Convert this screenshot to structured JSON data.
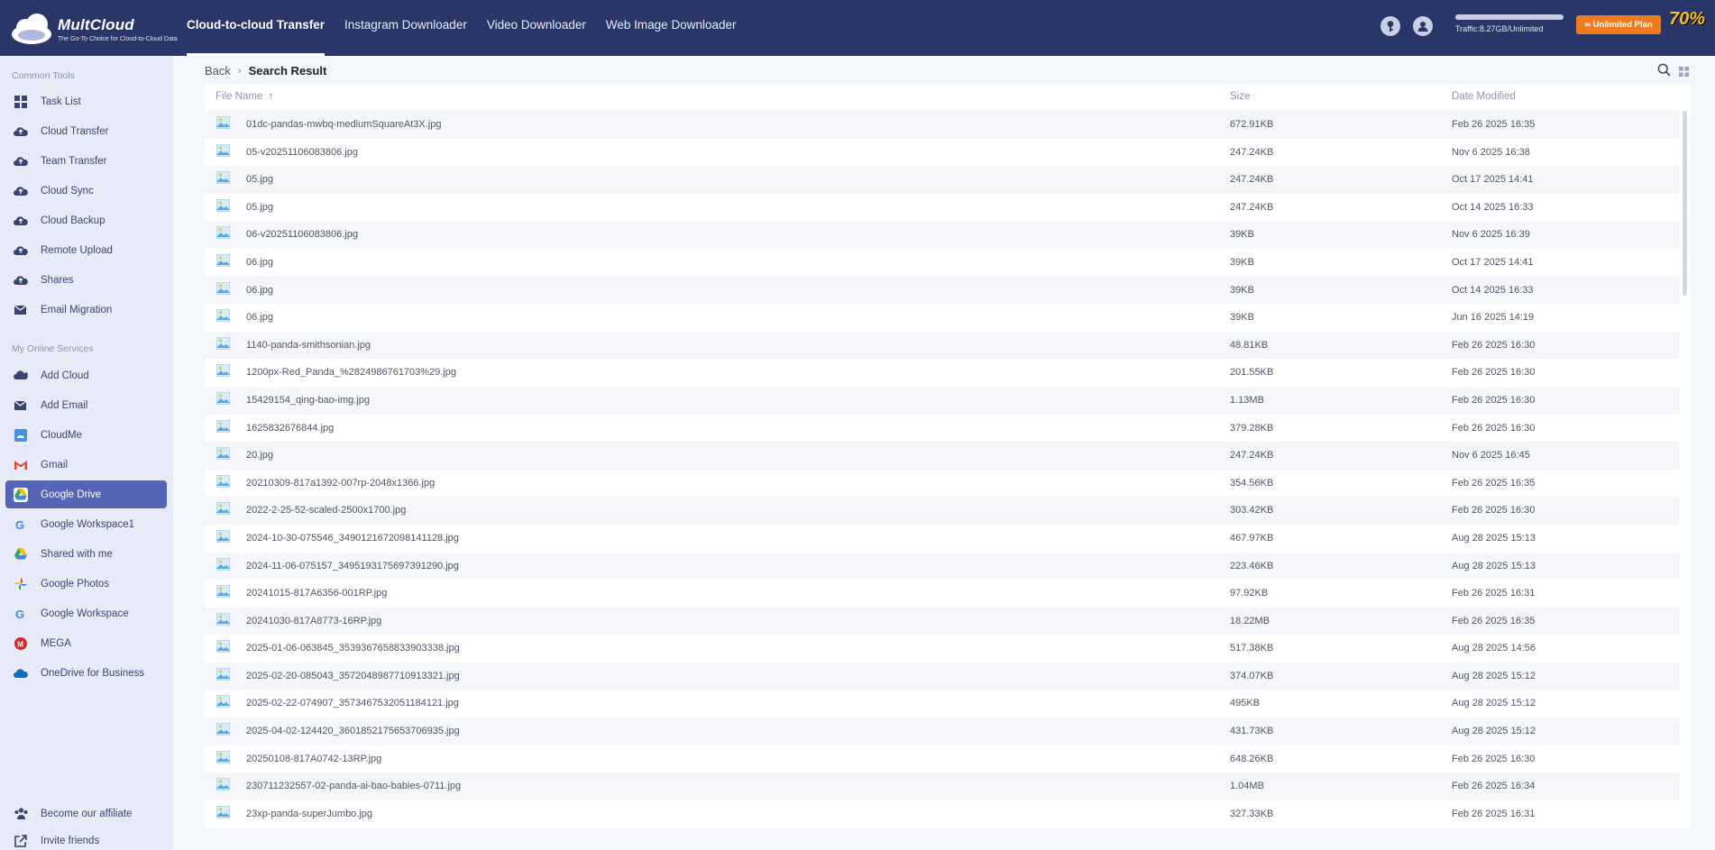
{
  "app": {
    "name": "MultCloud",
    "tagline": "The Go-To Choice for Cloud-to-Cloud Data"
  },
  "topnav": {
    "items": [
      {
        "label": "Cloud-to-cloud Transfer",
        "active": true
      },
      {
        "label": "Instagram Downloader",
        "active": false
      },
      {
        "label": "Video Downloader",
        "active": false
      },
      {
        "label": "Web Image Downloader",
        "active": false
      }
    ]
  },
  "header": {
    "traffic_text": "Traffic:8.27GB/Unlimited",
    "plan_label": "∞ Unlimited Plan",
    "promo_text": "70%"
  },
  "sidebar": {
    "common_title": "Common Tools",
    "common": [
      {
        "label": "Task List",
        "icon": "grid-icon"
      },
      {
        "label": "Cloud Transfer",
        "icon": "cloud-transfer-icon"
      },
      {
        "label": "Team Transfer",
        "icon": "team-transfer-icon"
      },
      {
        "label": "Cloud Sync",
        "icon": "cloud-sync-icon"
      },
      {
        "label": "Cloud Backup",
        "icon": "cloud-backup-icon"
      },
      {
        "label": "Remote Upload",
        "icon": "remote-upload-icon"
      },
      {
        "label": "Shares",
        "icon": "shares-icon"
      },
      {
        "label": "Email Migration",
        "icon": "email-migration-icon"
      }
    ],
    "services_title": "My Online Services",
    "services": [
      {
        "label": "Add Cloud",
        "icon": "add-cloud-icon"
      },
      {
        "label": "Add Email",
        "icon": "add-email-icon"
      },
      {
        "label": "CloudMe",
        "icon": "cloudme-icon"
      },
      {
        "label": "Gmail",
        "icon": "gmail-icon"
      },
      {
        "label": "Google Drive",
        "icon": "google-drive-icon",
        "active": true
      },
      {
        "label": "Google Workspace1",
        "icon": "google-icon"
      },
      {
        "label": "Shared with me",
        "icon": "google-drive-icon"
      },
      {
        "label": "Google Photos",
        "icon": "google-photos-icon"
      },
      {
        "label": "Google Workspace",
        "icon": "google-icon"
      },
      {
        "label": "MEGA",
        "icon": "mega-icon"
      },
      {
        "label": "OneDrive for Business",
        "icon": "onedrive-icon"
      }
    ],
    "footer": [
      {
        "label": "Become our affiliate",
        "icon": "affiliate-icon"
      },
      {
        "label": "Invite friends",
        "icon": "invite-icon"
      }
    ]
  },
  "breadcrumb": {
    "back": "Back",
    "current": "Search Result"
  },
  "table": {
    "columns": {
      "name": "File Name",
      "sort_indicator": "↑",
      "size": "Size",
      "date": "Date Modified"
    },
    "rows": [
      {
        "name": "01dc-pandas-mwbq-mediumSquareAt3X.jpg",
        "size": "672.91KB",
        "date": "Feb 26 2025 16:35"
      },
      {
        "name": "05-v20251106083806.jpg",
        "size": "247.24KB",
        "date": "Nov 6 2025 16:38"
      },
      {
        "name": "05.jpg",
        "size": "247.24KB",
        "date": "Oct 17 2025 14:41"
      },
      {
        "name": "05.jpg",
        "size": "247.24KB",
        "date": "Oct 14 2025 16:33"
      },
      {
        "name": "06-v20251106083806.jpg",
        "size": "39KB",
        "date": "Nov 6 2025 16:39"
      },
      {
        "name": "06.jpg",
        "size": "39KB",
        "date": "Oct 17 2025 14:41"
      },
      {
        "name": "06.jpg",
        "size": "39KB",
        "date": "Oct 14 2025 16:33"
      },
      {
        "name": "06.jpg",
        "size": "39KB",
        "date": "Jun 16 2025 14:19"
      },
      {
        "name": "1140-panda-smithsonian.jpg",
        "size": "48.81KB",
        "date": "Feb 26 2025 16:30"
      },
      {
        "name": "1200px-Red_Panda_%2824986761703%29.jpg",
        "size": "201.55KB",
        "date": "Feb 26 2025 16:30"
      },
      {
        "name": "15429154_qing-bao-img.jpg",
        "size": "1.13MB",
        "date": "Feb 26 2025 16:30"
      },
      {
        "name": "1625832676844.jpg",
        "size": "379.28KB",
        "date": "Feb 26 2025 16:30"
      },
      {
        "name": "20.jpg",
        "size": "247.24KB",
        "date": "Nov 6 2025 16:45"
      },
      {
        "name": "20210309-817a1392-007rp-2048x1366.jpg",
        "size": "354.56KB",
        "date": "Feb 26 2025 16:35"
      },
      {
        "name": "2022-2-25-52-scaled-2500x1700.jpg",
        "size": "303.42KB",
        "date": "Feb 26 2025 16:30"
      },
      {
        "name": "2024-10-30-075546_3490121672098141128.jpg",
        "size": "467.97KB",
        "date": "Aug 28 2025 15:13"
      },
      {
        "name": "2024-11-06-075157_3495193175697391290.jpg",
        "size": "223.46KB",
        "date": "Aug 28 2025 15:13"
      },
      {
        "name": "20241015-817A6356-001RP.jpg",
        "size": "97.92KB",
        "date": "Feb 26 2025 16:31"
      },
      {
        "name": "20241030-817A8773-16RP.jpg",
        "size": "18.22MB",
        "date": "Feb 26 2025 16:35"
      },
      {
        "name": "2025-01-06-063845_3539367658833903338.jpg",
        "size": "517.38KB",
        "date": "Aug 28 2025 14:56"
      },
      {
        "name": "2025-02-20-085043_3572048987710913321.jpg",
        "size": "374.07KB",
        "date": "Aug 28 2025 15:12"
      },
      {
        "name": "2025-02-22-074907_3573467532051184121.jpg",
        "size": "495KB",
        "date": "Aug 28 2025 15:12"
      },
      {
        "name": "2025-04-02-124420_3601852175653706935.jpg",
        "size": "431.73KB",
        "date": "Aug 28 2025 15:12"
      },
      {
        "name": "20250108-817A0742-13RP.jpg",
        "size": "648.26KB",
        "date": "Feb 26 2025 16:30"
      },
      {
        "name": "230711232557-02-panda-ai-bao-babies-0711.jpg",
        "size": "1.04MB",
        "date": "Feb 26 2025 16:34"
      },
      {
        "name": "23xp-panda-superJumbo.jpg",
        "size": "327.33KB",
        "date": "Feb 26 2025 16:31"
      }
    ]
  },
  "colors": {
    "topbar": "#2a3667",
    "sidebar": "#e7ebf8",
    "active_item": "#5565b3",
    "plan_button": "#f07b1d"
  }
}
